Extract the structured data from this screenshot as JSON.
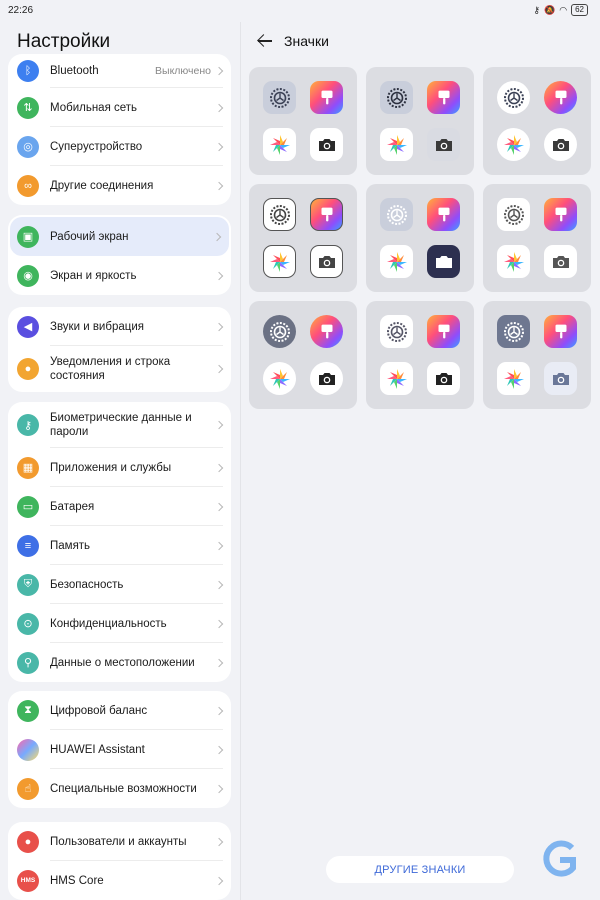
{
  "status": {
    "time": "22:26",
    "battery": "62"
  },
  "left": {
    "title": "Настройки",
    "groups": [
      {
        "items": [
          {
            "label": "Bluetooth",
            "value": "Выключено"
          },
          {
            "label": "Мобильная сеть"
          },
          {
            "label": "Суперустройство"
          },
          {
            "label": "Другие соединения"
          }
        ]
      },
      {
        "items": [
          {
            "label": "Рабочий экран"
          },
          {
            "label": "Экран и яркость"
          }
        ]
      },
      {
        "items": [
          {
            "label": "Звуки и вибрация"
          },
          {
            "label": "Уведомления и строка состояния"
          }
        ]
      },
      {
        "items": [
          {
            "label": "Биометрические данные и пароли"
          },
          {
            "label": "Приложения и службы"
          },
          {
            "label": "Батарея"
          },
          {
            "label": "Память"
          },
          {
            "label": "Безопасность"
          },
          {
            "label": "Конфиденциальность"
          },
          {
            "label": "Данные о местоположении"
          }
        ]
      },
      {
        "items": [
          {
            "label": "Цифровой баланс"
          },
          {
            "label": "HUAWEI Assistant"
          },
          {
            "label": "Специальные возможности"
          }
        ]
      },
      {
        "items": [
          {
            "label": "Пользователи и аккаунты"
          },
          {
            "label": "HMS Core",
            "icon_text": "HMS"
          }
        ]
      }
    ]
  },
  "right": {
    "title": "Значки",
    "more_button": "ДРУГИЕ ЗНАЧКИ"
  },
  "colors": {
    "accent": "#3f6ad8",
    "selected_row": "#e5ebfa",
    "tile": "#dcdde2"
  }
}
